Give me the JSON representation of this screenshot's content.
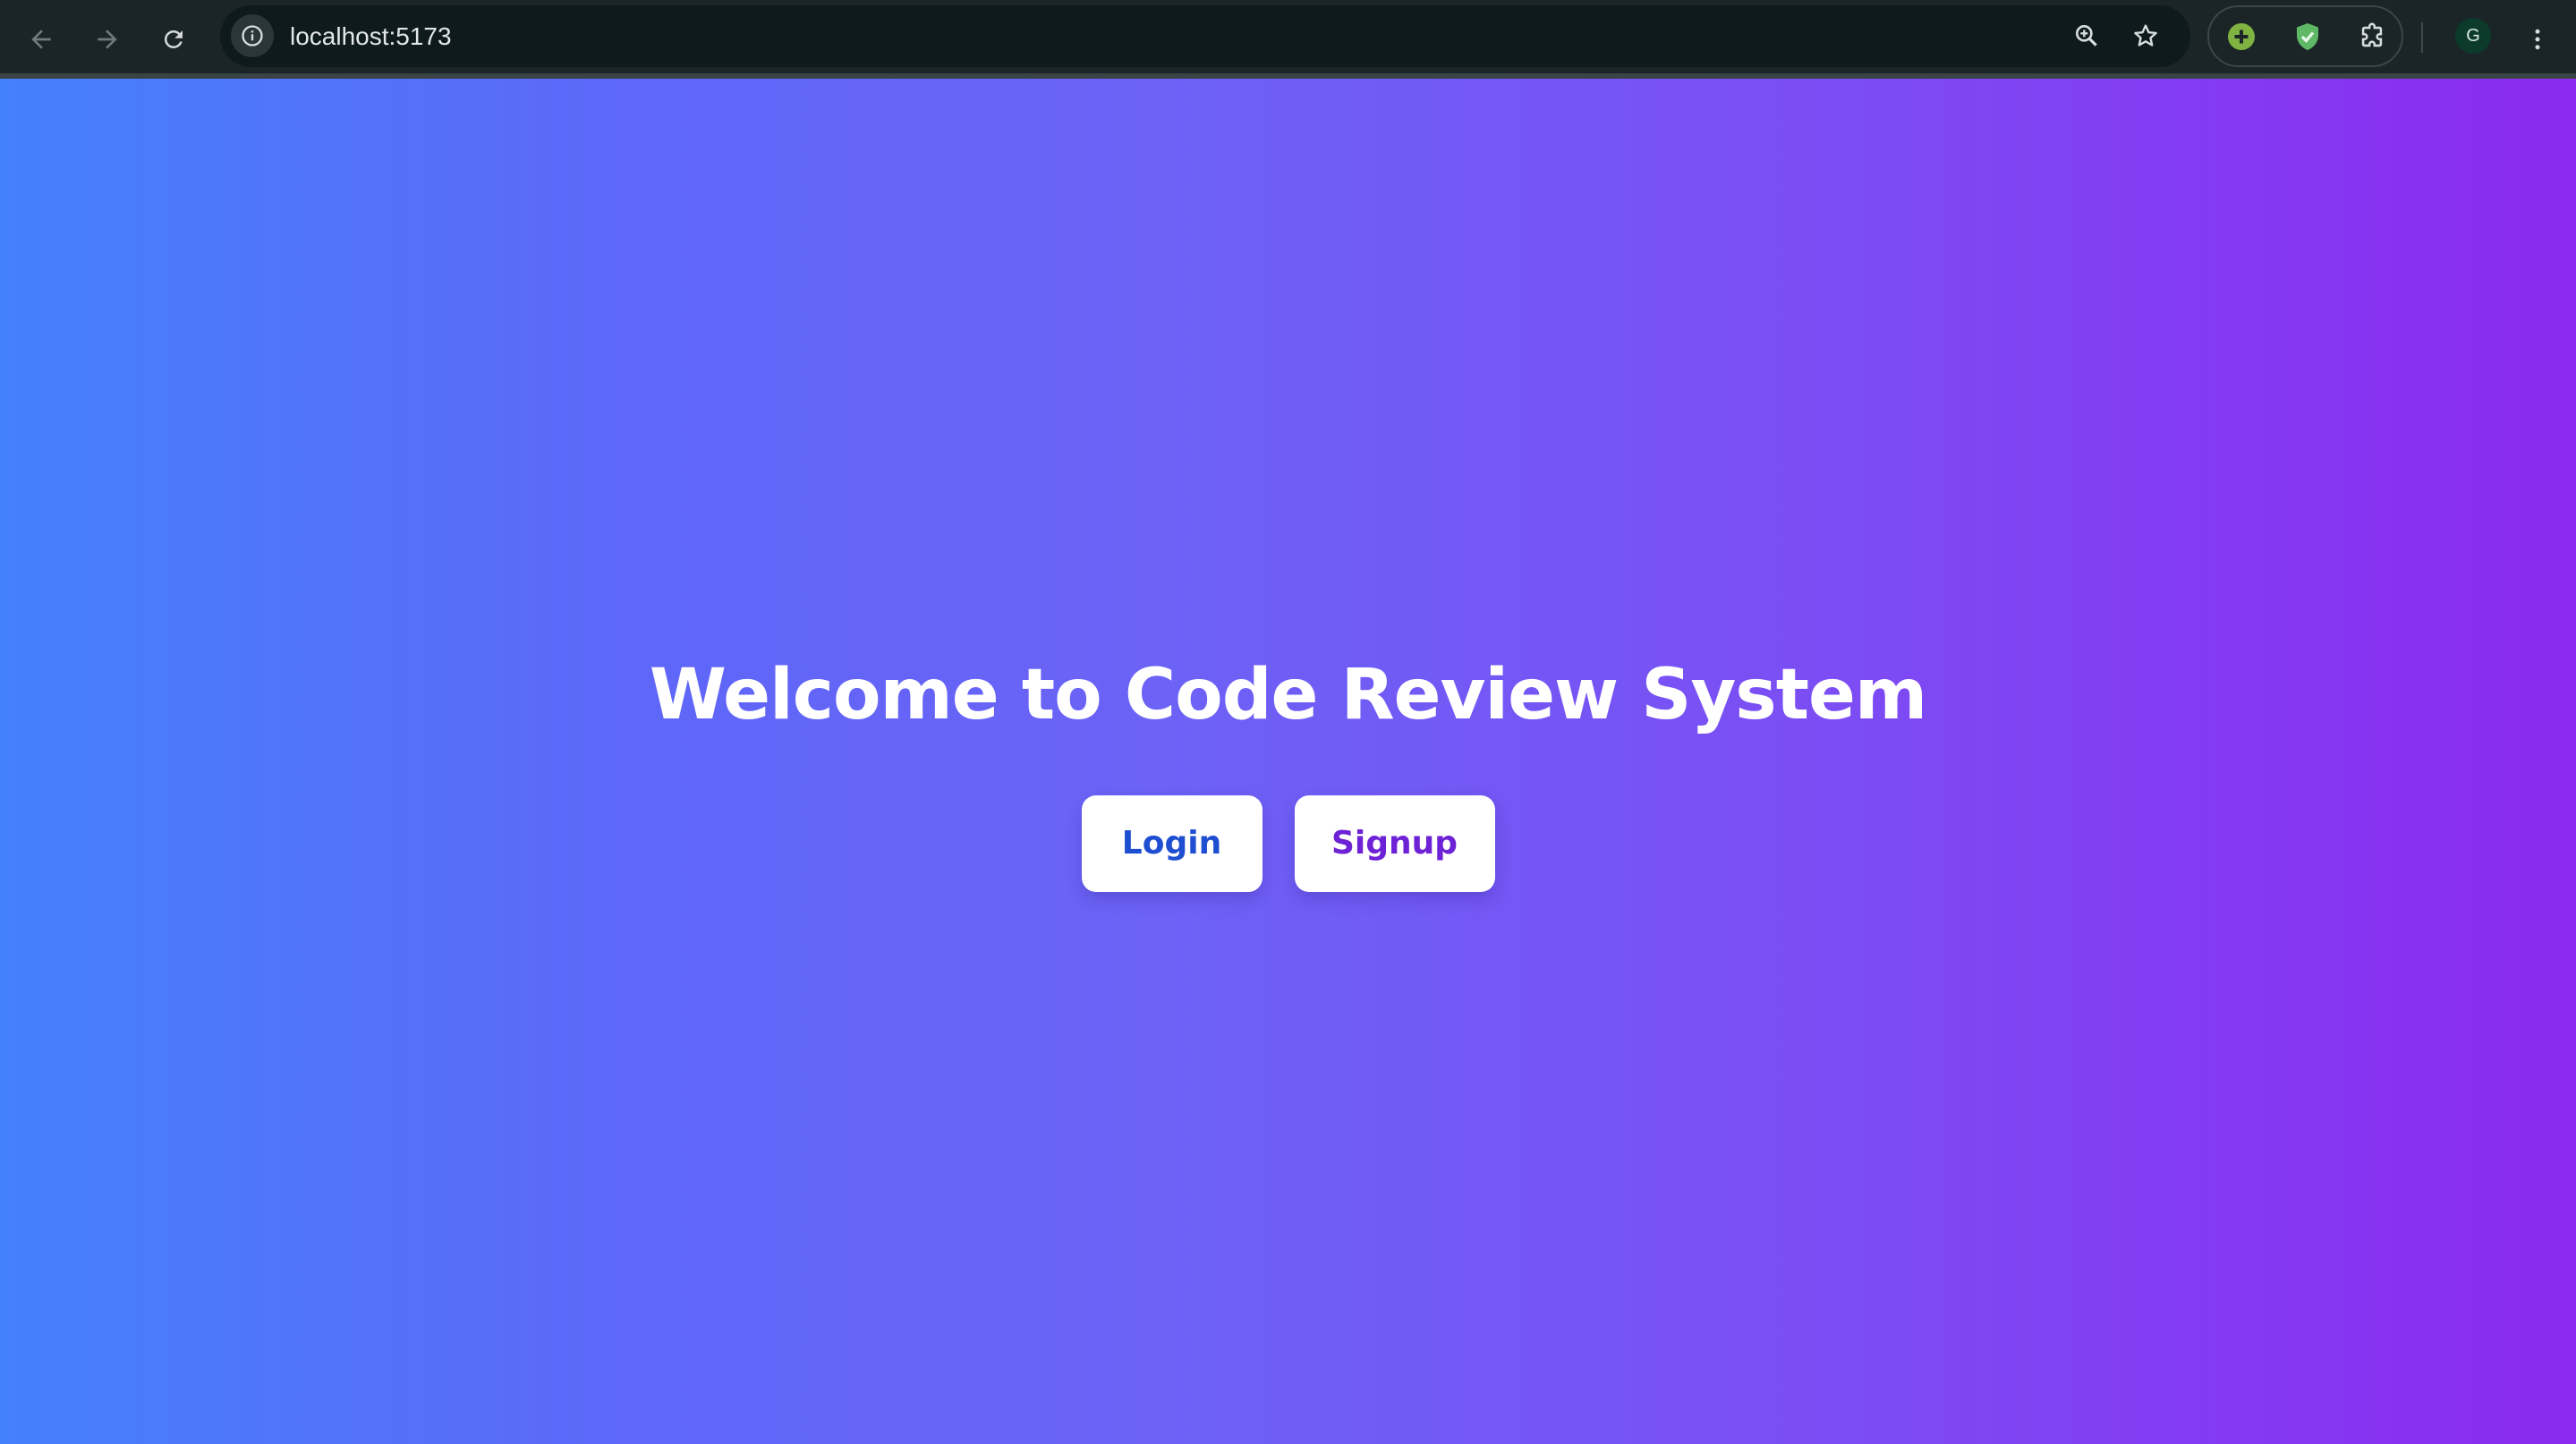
{
  "browser": {
    "url": "localhost:5173",
    "profile_initial": "G",
    "icons": {
      "back": "arrow-left-icon",
      "forward": "arrow-right-icon",
      "reload": "reload-icon",
      "site_info": "info-icon",
      "zoom": "zoom-in-icon",
      "bookmark": "star-icon",
      "extension_1": "green-plus-extension-icon",
      "extension_2": "green-shield-extension-icon",
      "extensions_menu": "puzzle-icon",
      "menu": "vertical-dots-icon"
    }
  },
  "page": {
    "title": "Welcome to Code Review System",
    "login_label": "Login",
    "signup_label": "Signup"
  },
  "colors": {
    "gradient_start": "#4580fb",
    "gradient_end": "#8b2af0",
    "login_text": "#1f4fd1",
    "signup_text": "#6e22d6"
  }
}
